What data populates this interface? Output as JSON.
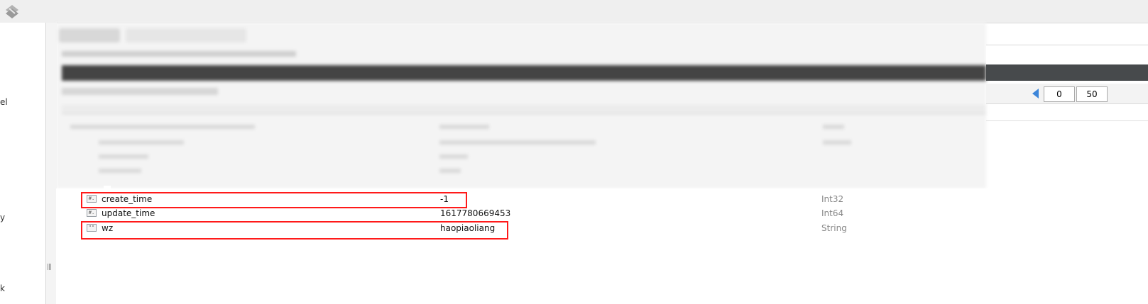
{
  "sidebar": {
    "fragments": [
      "el",
      "y",
      "k"
    ]
  },
  "pager": {
    "skip": "0",
    "limit": "50"
  },
  "document_fields": [
    {
      "name": "create_time",
      "value": "-1",
      "type": "Int32",
      "icon": "number-field-icon",
      "glyph": "#."
    },
    {
      "name": "update_time",
      "value": "1617780669453",
      "type": "Int64",
      "icon": "number-field-icon",
      "glyph": "#."
    },
    {
      "name": "wz",
      "value": "haopiaoliang",
      "type": "String",
      "icon": "string-field-icon",
      "glyph": "\"\""
    }
  ],
  "highlight_color": "#ff1a1a"
}
